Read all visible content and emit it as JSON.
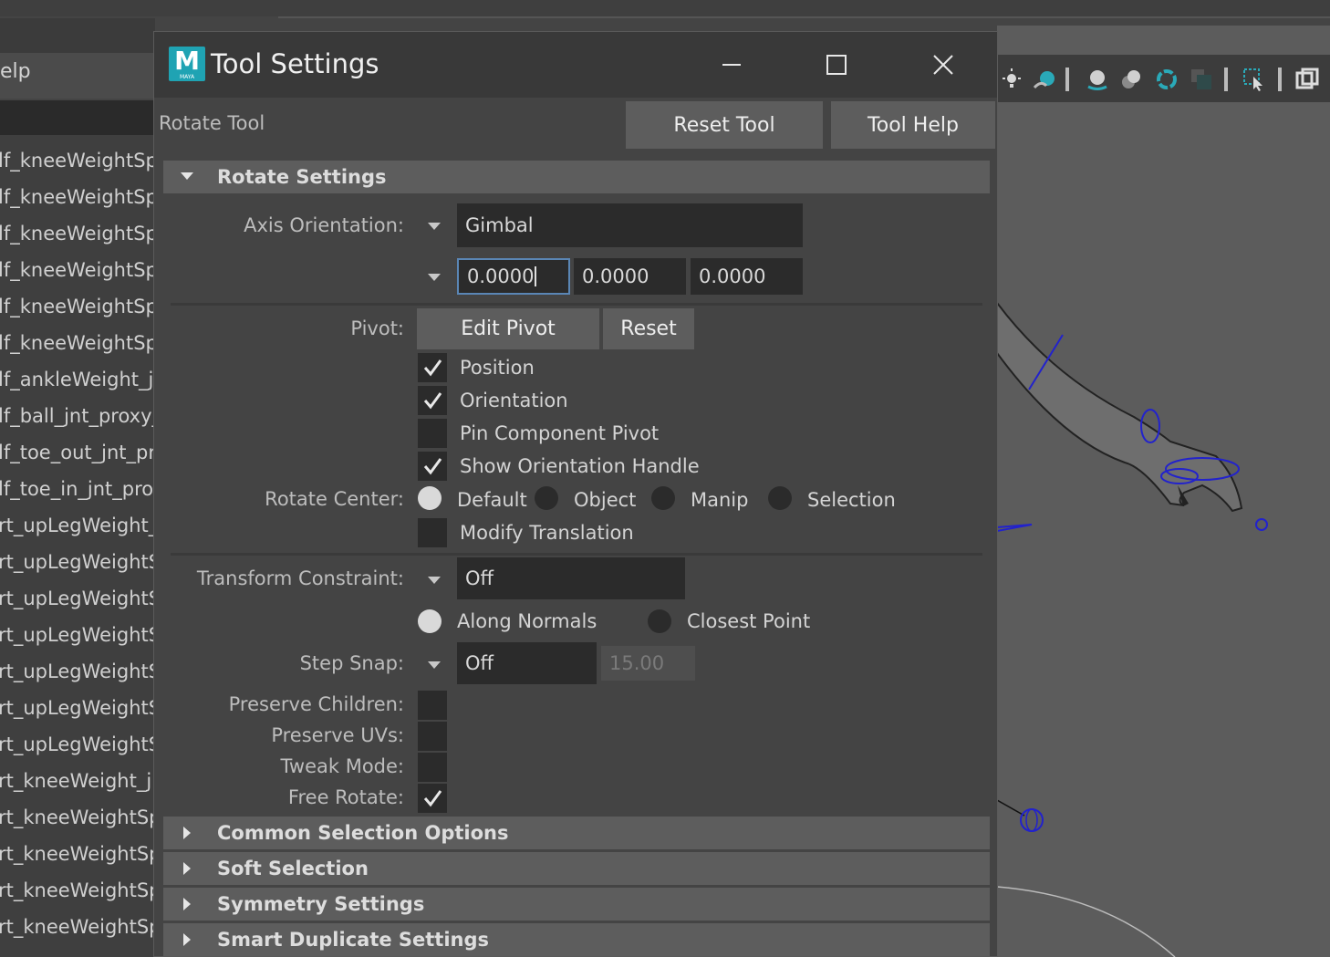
{
  "background": {
    "help_menu": "elp",
    "outliner_items": [
      "lf_kneeWeightSpl",
      "lf_kneeWeightSpl",
      "lf_kneeWeightSpl",
      "lf_kneeWeightSpl",
      "lf_kneeWeightSpl",
      "lf_kneeWeightSpl",
      "lf_ankleWeight_jn",
      "lf_ball_jnt_proxy_g",
      "lf_toe_out_jnt_pro",
      "lf_toe_in_jnt_proxy",
      "rt_upLegWeight_j",
      "rt_upLegWeightS",
      "rt_upLegWeightS",
      "rt_upLegWeightS",
      "rt_upLegWeightS",
      "rt_upLegWeightS",
      "rt_upLegWeightS",
      "rt_kneeWeight_jn",
      "rt_kneeWeightSp",
      "rt_kneeWeightSp",
      "rt_kneeWeightSp",
      "rt_kneeWeightSp"
    ],
    "viewport_icons": [
      "light-icon",
      "shading-icon",
      "lit-sphere-icon",
      "shadow-icon",
      "ambient-occlusion-icon",
      "texture-icon",
      "select-region-icon",
      "panel-layout-icon"
    ]
  },
  "window": {
    "title": "Tool Settings",
    "logo_text": "M",
    "logo_sub": "MAYA",
    "controls": [
      "minimize-icon",
      "maximize-icon",
      "close-icon"
    ]
  },
  "tool": {
    "name": "Rotate Tool",
    "reset_label": "Reset Tool",
    "help_label": "Tool Help"
  },
  "rotate_settings": {
    "header": "Rotate Settings",
    "expanded": true,
    "axis_orientation_label": "Axis Orientation:",
    "axis_orientation_value": "Gimbal",
    "axis_values": [
      "0.0000",
      "0.0000",
      "0.0000"
    ],
    "pivot_label": "Pivot:",
    "edit_pivot_label": "Edit Pivot",
    "reset_label": "Reset",
    "position": {
      "label": "Position",
      "checked": true
    },
    "orientation": {
      "label": "Orientation",
      "checked": true
    },
    "pin_component_pivot": {
      "label": "Pin Component Pivot",
      "checked": false
    },
    "show_orientation_handle": {
      "label": "Show Orientation Handle",
      "checked": true
    },
    "rotate_center_label": "Rotate Center:",
    "rotate_center_options": [
      "Default",
      "Object",
      "Manip",
      "Selection"
    ],
    "rotate_center_selected": "Default",
    "modify_translation": {
      "label": "Modify Translation",
      "checked": false
    },
    "transform_constraint_label": "Transform Constraint:",
    "transform_constraint_value": "Off",
    "constraint_options": [
      "Along Normals",
      "Closest Point"
    ],
    "constraint_selected": "Along Normals",
    "step_snap_label": "Step Snap:",
    "step_snap_value": "Off",
    "step_snap_amount": "15.00",
    "preserve_children": {
      "label": "Preserve Children:",
      "checked": false
    },
    "preserve_uvs": {
      "label": "Preserve UVs:",
      "checked": false
    },
    "tweak_mode": {
      "label": "Tweak Mode:",
      "checked": false
    },
    "free_rotate": {
      "label": "Free Rotate:",
      "checked": true
    }
  },
  "collapsed_sections": [
    "Common Selection Options",
    "Soft Selection",
    "Symmetry Settings",
    "Smart Duplicate Settings"
  ],
  "colors": {
    "window_bg": "#444444",
    "section_header": "#5d5d5d",
    "field_bg": "#2b2b2b",
    "focus_border": "#5a86b5",
    "maya_teal": "#1fa3b3",
    "skeleton_blue": "#2222cc"
  }
}
